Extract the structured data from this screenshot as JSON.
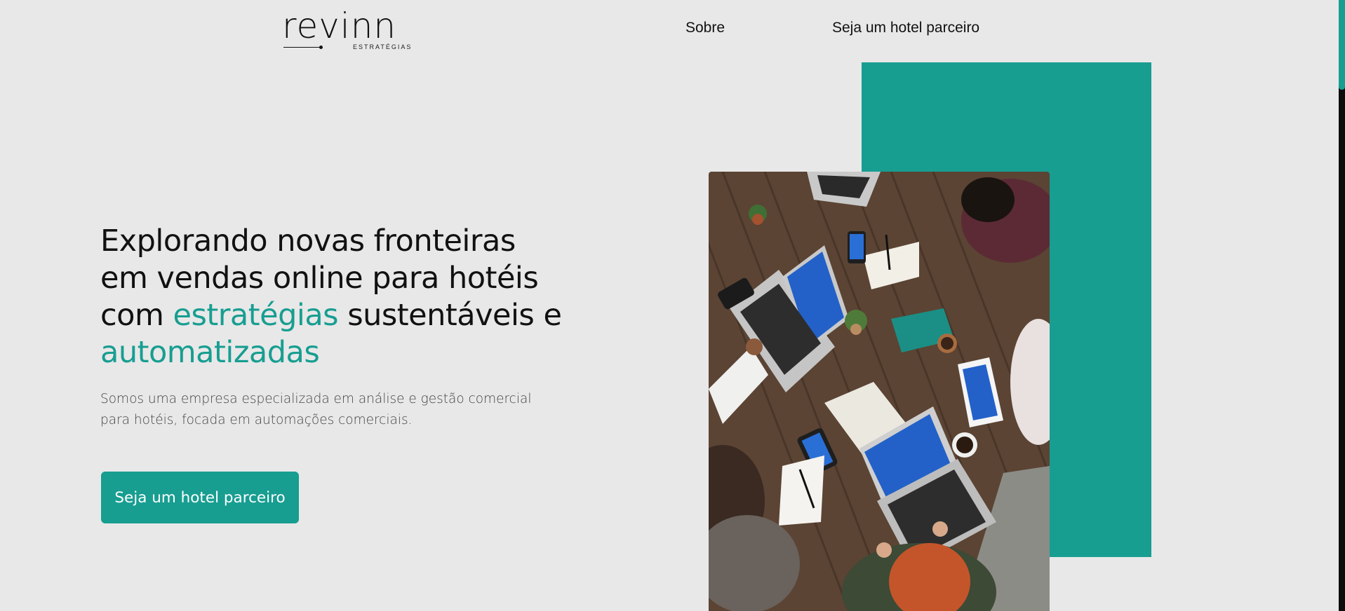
{
  "header": {
    "logo_word": "revinn",
    "logo_sub": "ESTRATÉGIAS",
    "nav": [
      {
        "label": "Sobre"
      },
      {
        "label": "Seja um hotel parceiro"
      }
    ]
  },
  "hero": {
    "title_part1": "Explorando novas fronteiras em vendas online para hotéis com ",
    "title_accent1": "estratégias",
    "title_part2": " sustentáveis e ",
    "title_accent2": "automatizadas",
    "description": "Somos uma empresa especializada em análise e gestão comercial para hotéis, focada em automações comerciais.",
    "cta_label": "Seja um hotel parceiro"
  },
  "colors": {
    "accent": "#179e91",
    "background": "#e8e8e8",
    "text": "#111111"
  },
  "icons": {
    "photo": "team-meeting-photo"
  }
}
